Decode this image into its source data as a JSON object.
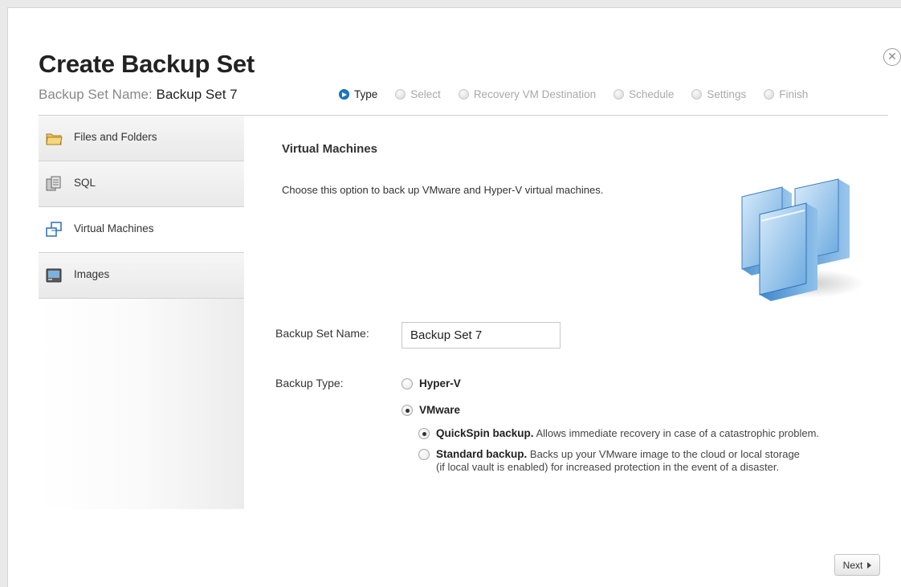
{
  "dialog": {
    "title": "Create Backup Set",
    "subtitle_label": "Backup Set Name:",
    "subtitle_value": "Backup Set 7"
  },
  "steps": [
    {
      "label": "Type",
      "active": true
    },
    {
      "label": "Select",
      "active": false
    },
    {
      "label": "Recovery VM Destination",
      "active": false
    },
    {
      "label": "Schedule",
      "active": false
    },
    {
      "label": "Settings",
      "active": false
    },
    {
      "label": "Finish",
      "active": false
    }
  ],
  "sidebar": {
    "items": [
      {
        "label": "Files and Folders",
        "icon": "folder-icon",
        "selected": false
      },
      {
        "label": "SQL",
        "icon": "database-icon",
        "selected": false
      },
      {
        "label": "Virtual Machines",
        "icon": "virtual-machines-icon",
        "selected": true
      },
      {
        "label": "Images",
        "icon": "disk-image-icon",
        "selected": false
      }
    ]
  },
  "main": {
    "title": "Virtual Machines",
    "description": "Choose this option to back up VMware and Hyper-V virtual machines.",
    "name_label": "Backup Set Name:",
    "name_value": "Backup Set 7",
    "type_label": "Backup Type:",
    "options": {
      "hyperv": {
        "label": "Hyper-V",
        "checked": false
      },
      "vmware": {
        "label": "VMware",
        "checked": true
      },
      "quickspin": {
        "label": "QuickSpin backup.",
        "desc": "Allows immediate recovery in case of a catastrophic problem.",
        "checked": true
      },
      "standard": {
        "label": "Standard backup.",
        "desc1": "Backs up your VMware image to the cloud or local storage",
        "desc2": "(if local vault is enabled) for increased protection in the event of a disaster.",
        "checked": false
      }
    }
  },
  "footer": {
    "next_label": "Next"
  },
  "colors": {
    "accent": "#1e78c2",
    "vm_blue": "#5aa0d8"
  }
}
